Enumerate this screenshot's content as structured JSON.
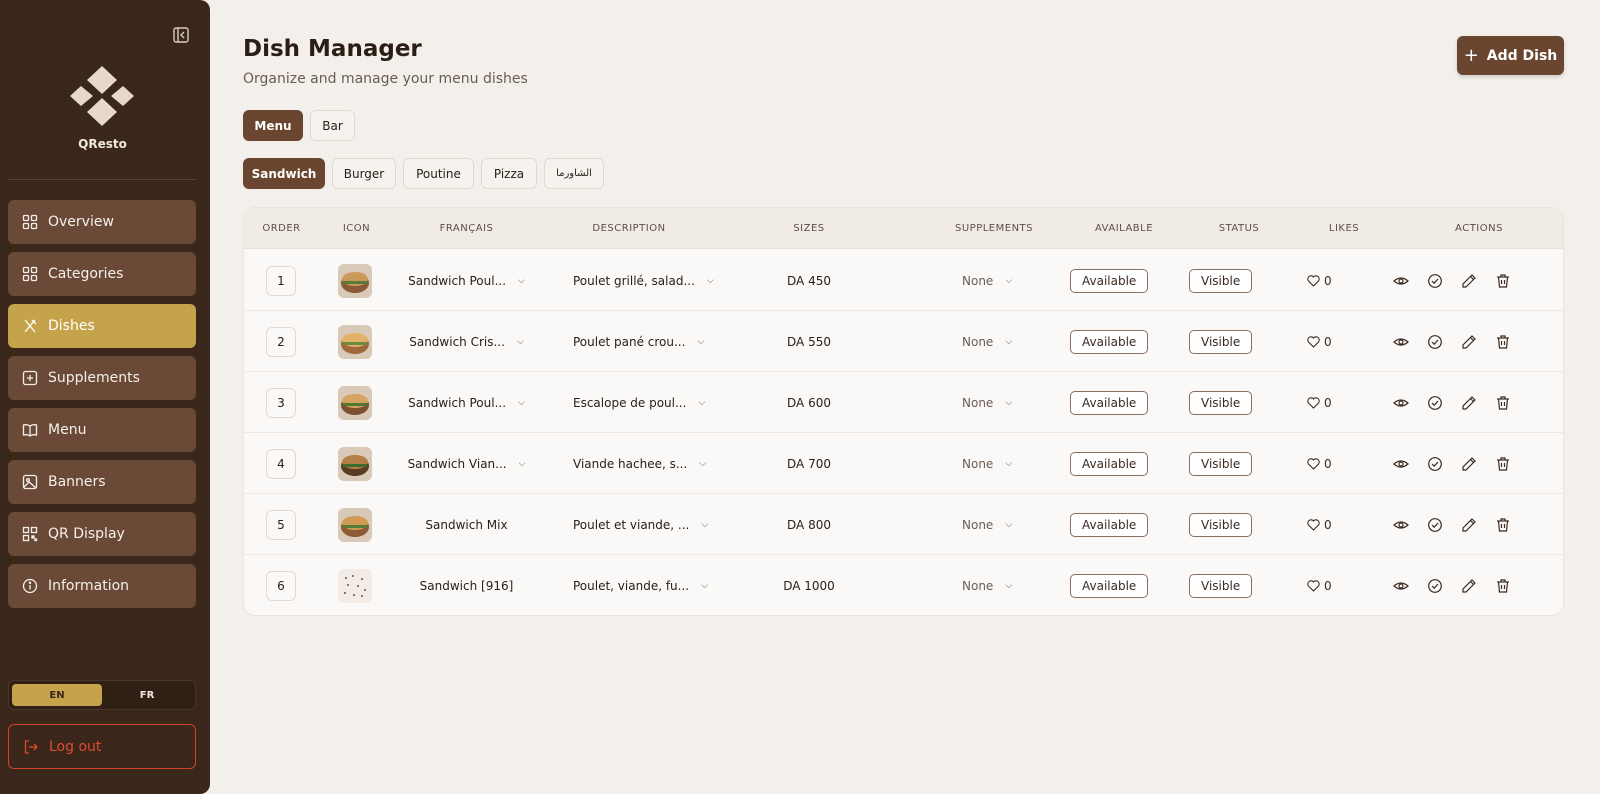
{
  "sidebar": {
    "brand": "QResto",
    "items": [
      {
        "label": "Overview",
        "icon": "grid-icon",
        "active": false
      },
      {
        "label": "Categories",
        "icon": "grid-icon",
        "active": false
      },
      {
        "label": "Dishes",
        "icon": "utensils-icon",
        "active": true
      },
      {
        "label": "Supplements",
        "icon": "plus-square-icon",
        "active": false
      },
      {
        "label": "Menu",
        "icon": "book-icon",
        "active": false
      },
      {
        "label": "Banners",
        "icon": "image-icon",
        "active": false
      },
      {
        "label": "QR Display",
        "icon": "qr-icon",
        "active": false
      },
      {
        "label": "Information",
        "icon": "info-icon",
        "active": false
      }
    ],
    "languages": [
      "EN",
      "FR"
    ],
    "active_language": "EN",
    "logout_label": "Log out"
  },
  "header": {
    "title": "Dish Manager",
    "subtitle": "Organize and manage your menu dishes",
    "add_label": "Add Dish"
  },
  "menu_tabs": [
    "Menu",
    "Bar"
  ],
  "active_menu_tab": "Menu",
  "category_tabs": [
    "Sandwich",
    "Burger",
    "Poutine",
    "Pizza",
    "الشاورما"
  ],
  "active_category": "Sandwich",
  "table": {
    "columns": [
      "ORDER",
      "ICON",
      "FRANÇAIS",
      "DESCRIPTION",
      "SIZES",
      "SUPPLEMENTS",
      "AVAILABLE",
      "STATUS",
      "LIKES",
      "ACTIONS"
    ],
    "rows": [
      {
        "order": "1",
        "name": "Sandwich Poul...",
        "name_dropdown": true,
        "description": "Poulet grillé, salad...",
        "sizes": "DA 450",
        "supplements": "None",
        "available": "Available",
        "status": "Visible",
        "likes": "0"
      },
      {
        "order": "2",
        "name": "Sandwich Cris...",
        "name_dropdown": true,
        "description": "Poulet pané crou...",
        "sizes": "DA 550",
        "supplements": "None",
        "available": "Available",
        "status": "Visible",
        "likes": "0"
      },
      {
        "order": "3",
        "name": "Sandwich Poul...",
        "name_dropdown": true,
        "description": "Escalope de poul...",
        "sizes": "DA 600",
        "supplements": "None",
        "available": "Available",
        "status": "Visible",
        "likes": "0"
      },
      {
        "order": "4",
        "name": "Sandwich Vian...",
        "name_dropdown": true,
        "description": "Viande hachee, s...",
        "sizes": "DA 700",
        "supplements": "None",
        "available": "Available",
        "status": "Visible",
        "likes": "0"
      },
      {
        "order": "5",
        "name": "Sandwich Mix",
        "name_dropdown": false,
        "description": "Poulet et viande, ...",
        "sizes": "DA 800",
        "supplements": "None",
        "available": "Available",
        "status": "Visible",
        "likes": "0"
      },
      {
        "order": "6",
        "name": "Sandwich [916]",
        "name_dropdown": false,
        "description": "Poulet, viande, fu...",
        "sizes": "DA 1000",
        "supplements": "None",
        "available": "Available",
        "status": "Visible",
        "likes": "0"
      }
    ],
    "row_actions": [
      "eye-icon",
      "check-circle-icon",
      "pencil-icon",
      "trash-icon"
    ]
  },
  "colors": {
    "sidebar_bg": "#3a261a",
    "nav_item": "#6a4a37",
    "accent_gold": "#c4a34b",
    "primary_brown": "#6a4530",
    "danger": "#e04a2f"
  }
}
